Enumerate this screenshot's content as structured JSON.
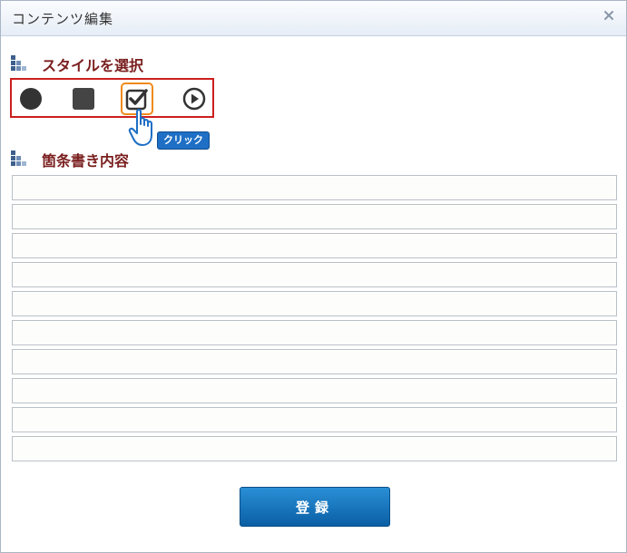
{
  "dialog": {
    "title": "コンテンツ編集",
    "close_icon": "close-icon"
  },
  "style_section": {
    "heading": "スタイルを選択",
    "heading_icon": "bar-chart-icon",
    "options": [
      {
        "name": "circle",
        "icon": "filled-circle-icon",
        "selected": false
      },
      {
        "name": "square",
        "icon": "filled-square-icon",
        "selected": false
      },
      {
        "name": "checkbox",
        "icon": "checkbox-icon",
        "selected": true
      },
      {
        "name": "play",
        "icon": "play-circle-icon",
        "selected": false
      }
    ],
    "click_hint": "クリック"
  },
  "bullets_section": {
    "heading": "箇条書き内容",
    "heading_icon": "bar-chart-icon",
    "items": [
      "",
      "",
      "",
      "",
      "",
      "",
      "",
      "",
      "",
      ""
    ]
  },
  "actions": {
    "register_label": "登録"
  },
  "colors": {
    "heading": "#7a1f1f",
    "highlight_border": "#cc1e1e",
    "selected_frame": "#f08a1c",
    "button": "#0a5fa4",
    "badge": "#1e6fc5"
  }
}
